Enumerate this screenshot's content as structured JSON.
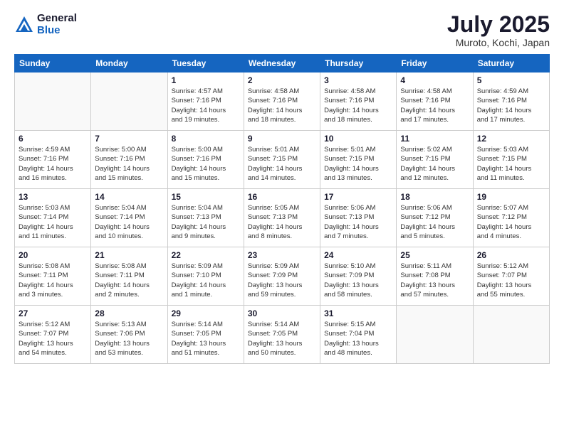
{
  "logo": {
    "general": "General",
    "blue": "Blue"
  },
  "title": "July 2025",
  "location": "Muroto, Kochi, Japan",
  "headers": [
    "Sunday",
    "Monday",
    "Tuesday",
    "Wednesday",
    "Thursday",
    "Friday",
    "Saturday"
  ],
  "weeks": [
    [
      {
        "day": "",
        "info": ""
      },
      {
        "day": "",
        "info": ""
      },
      {
        "day": "1",
        "info": "Sunrise: 4:57 AM\nSunset: 7:16 PM\nDaylight: 14 hours\nand 19 minutes."
      },
      {
        "day": "2",
        "info": "Sunrise: 4:58 AM\nSunset: 7:16 PM\nDaylight: 14 hours\nand 18 minutes."
      },
      {
        "day": "3",
        "info": "Sunrise: 4:58 AM\nSunset: 7:16 PM\nDaylight: 14 hours\nand 18 minutes."
      },
      {
        "day": "4",
        "info": "Sunrise: 4:58 AM\nSunset: 7:16 PM\nDaylight: 14 hours\nand 17 minutes."
      },
      {
        "day": "5",
        "info": "Sunrise: 4:59 AM\nSunset: 7:16 PM\nDaylight: 14 hours\nand 17 minutes."
      }
    ],
    [
      {
        "day": "6",
        "info": "Sunrise: 4:59 AM\nSunset: 7:16 PM\nDaylight: 14 hours\nand 16 minutes."
      },
      {
        "day": "7",
        "info": "Sunrise: 5:00 AM\nSunset: 7:16 PM\nDaylight: 14 hours\nand 15 minutes."
      },
      {
        "day": "8",
        "info": "Sunrise: 5:00 AM\nSunset: 7:16 PM\nDaylight: 14 hours\nand 15 minutes."
      },
      {
        "day": "9",
        "info": "Sunrise: 5:01 AM\nSunset: 7:15 PM\nDaylight: 14 hours\nand 14 minutes."
      },
      {
        "day": "10",
        "info": "Sunrise: 5:01 AM\nSunset: 7:15 PM\nDaylight: 14 hours\nand 13 minutes."
      },
      {
        "day": "11",
        "info": "Sunrise: 5:02 AM\nSunset: 7:15 PM\nDaylight: 14 hours\nand 12 minutes."
      },
      {
        "day": "12",
        "info": "Sunrise: 5:03 AM\nSunset: 7:15 PM\nDaylight: 14 hours\nand 11 minutes."
      }
    ],
    [
      {
        "day": "13",
        "info": "Sunrise: 5:03 AM\nSunset: 7:14 PM\nDaylight: 14 hours\nand 11 minutes."
      },
      {
        "day": "14",
        "info": "Sunrise: 5:04 AM\nSunset: 7:14 PM\nDaylight: 14 hours\nand 10 minutes."
      },
      {
        "day": "15",
        "info": "Sunrise: 5:04 AM\nSunset: 7:13 PM\nDaylight: 14 hours\nand 9 minutes."
      },
      {
        "day": "16",
        "info": "Sunrise: 5:05 AM\nSunset: 7:13 PM\nDaylight: 14 hours\nand 8 minutes."
      },
      {
        "day": "17",
        "info": "Sunrise: 5:06 AM\nSunset: 7:13 PM\nDaylight: 14 hours\nand 7 minutes."
      },
      {
        "day": "18",
        "info": "Sunrise: 5:06 AM\nSunset: 7:12 PM\nDaylight: 14 hours\nand 5 minutes."
      },
      {
        "day": "19",
        "info": "Sunrise: 5:07 AM\nSunset: 7:12 PM\nDaylight: 14 hours\nand 4 minutes."
      }
    ],
    [
      {
        "day": "20",
        "info": "Sunrise: 5:08 AM\nSunset: 7:11 PM\nDaylight: 14 hours\nand 3 minutes."
      },
      {
        "day": "21",
        "info": "Sunrise: 5:08 AM\nSunset: 7:11 PM\nDaylight: 14 hours\nand 2 minutes."
      },
      {
        "day": "22",
        "info": "Sunrise: 5:09 AM\nSunset: 7:10 PM\nDaylight: 14 hours\nand 1 minute."
      },
      {
        "day": "23",
        "info": "Sunrise: 5:09 AM\nSunset: 7:09 PM\nDaylight: 13 hours\nand 59 minutes."
      },
      {
        "day": "24",
        "info": "Sunrise: 5:10 AM\nSunset: 7:09 PM\nDaylight: 13 hours\nand 58 minutes."
      },
      {
        "day": "25",
        "info": "Sunrise: 5:11 AM\nSunset: 7:08 PM\nDaylight: 13 hours\nand 57 minutes."
      },
      {
        "day": "26",
        "info": "Sunrise: 5:12 AM\nSunset: 7:07 PM\nDaylight: 13 hours\nand 55 minutes."
      }
    ],
    [
      {
        "day": "27",
        "info": "Sunrise: 5:12 AM\nSunset: 7:07 PM\nDaylight: 13 hours\nand 54 minutes."
      },
      {
        "day": "28",
        "info": "Sunrise: 5:13 AM\nSunset: 7:06 PM\nDaylight: 13 hours\nand 53 minutes."
      },
      {
        "day": "29",
        "info": "Sunrise: 5:14 AM\nSunset: 7:05 PM\nDaylight: 13 hours\nand 51 minutes."
      },
      {
        "day": "30",
        "info": "Sunrise: 5:14 AM\nSunset: 7:05 PM\nDaylight: 13 hours\nand 50 minutes."
      },
      {
        "day": "31",
        "info": "Sunrise: 5:15 AM\nSunset: 7:04 PM\nDaylight: 13 hours\nand 48 minutes."
      },
      {
        "day": "",
        "info": ""
      },
      {
        "day": "",
        "info": ""
      }
    ]
  ]
}
